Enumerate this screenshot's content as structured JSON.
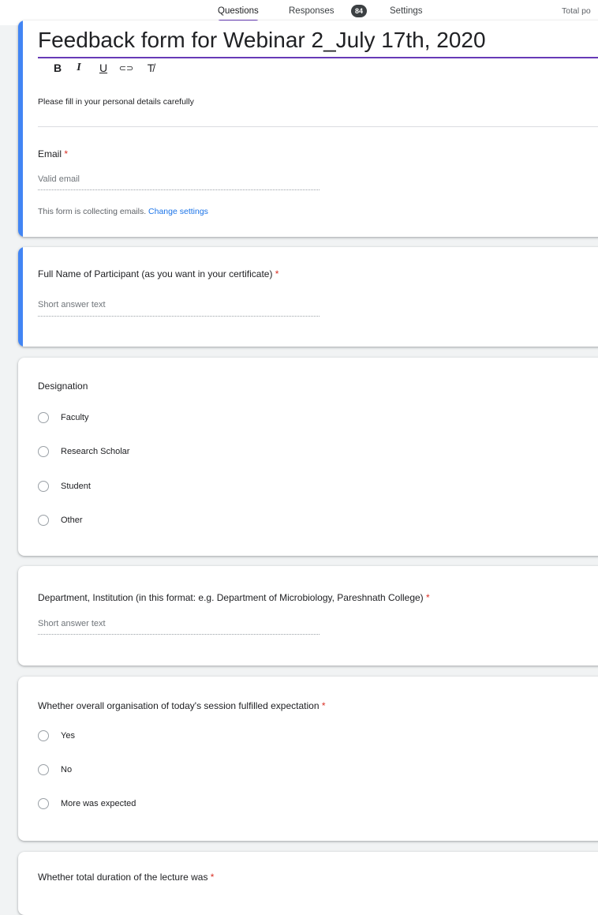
{
  "tabs": {
    "questions": "Questions",
    "responses": "Responses",
    "responses_count": "84",
    "settings": "Settings",
    "total_points": "Total po"
  },
  "header": {
    "title": "Feedback form for Webinar 2_July 17th, 2020",
    "toolbar": {
      "bold": "B",
      "italic": "I",
      "underline": "U",
      "link": "⊂⊃",
      "clear": "T̸"
    },
    "description": "Please fill in your personal details carefully"
  },
  "email": {
    "label": "Email",
    "required_mark": "*",
    "placeholder": "Valid email",
    "note": "This form is collecting emails.",
    "note_link": "Change settings"
  },
  "questions": [
    {
      "label": "Full Name of Participant (as you want in your certificate)",
      "required_mark": "*",
      "placeholder": "Short answer text"
    },
    {
      "label": "Designation",
      "options": [
        "Faculty",
        "Research Scholar",
        "Student",
        "Other"
      ]
    },
    {
      "label": "Department, Institution (in this format: e.g. Department of Microbiology, Pareshnath College)",
      "required_mark": "*",
      "placeholder": "Short answer text"
    },
    {
      "label": "Whether overall organisation of today's session fulfilled expectation",
      "required_mark": "*",
      "options": [
        "Yes",
        "No",
        "More was expected"
      ]
    },
    {
      "label": "Whether total duration of the lecture was",
      "required_mark": "*"
    }
  ],
  "colors": {
    "accent": "#673ab7",
    "active_bar": "#4285f4",
    "required": "#d93025",
    "link": "#1a73e8"
  }
}
